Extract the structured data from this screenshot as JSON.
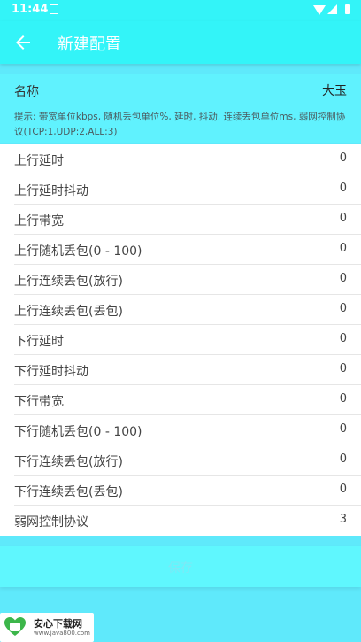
{
  "status_bar": {
    "time": "11:44"
  },
  "app_bar": {
    "title": "新建配置"
  },
  "name_field": {
    "label": "名称",
    "value": "大玉"
  },
  "hint": "提示: 带宽单位kbps, 随机丢包单位%, 延时, 抖动, 连续丢包单位ms, 弱网控制协议(TCP:1,UDP:2,ALL:3)",
  "settings": [
    {
      "label": "上行延时",
      "value": "0"
    },
    {
      "label": "上行延时抖动",
      "value": "0"
    },
    {
      "label": "上行带宽",
      "value": "0"
    },
    {
      "label": "上行随机丢包(0 - 100)",
      "value": "0"
    },
    {
      "label": "上行连续丢包(放行)",
      "value": "0"
    },
    {
      "label": "上行连续丢包(丢包)",
      "value": "0"
    },
    {
      "label": "下行延时",
      "value": "0"
    },
    {
      "label": "下行延时抖动",
      "value": "0"
    },
    {
      "label": "下行带宽",
      "value": "0"
    },
    {
      "label": "下行随机丢包(0 - 100)",
      "value": "0"
    },
    {
      "label": "下行连续丢包(放行)",
      "value": "0"
    },
    {
      "label": "下行连续丢包(丢包)",
      "value": "0"
    },
    {
      "label": "弱网控制协议",
      "value": "3"
    }
  ],
  "save_button": {
    "label": "保存"
  },
  "watermark": {
    "title": "安心下载网",
    "url": "www.java800.com"
  },
  "icons": {
    "back": "arrow-left-icon",
    "notification": "notification-icon",
    "wifi": "wifi-icon",
    "signal": "signal-icon",
    "battery": "battery-icon",
    "watermark_logo": "heart-logo-icon"
  },
  "colors": {
    "app_bar": "#33f4f8",
    "background": "#5fe9fb",
    "list_background": "#ffffff",
    "save_text": "#7fe7f4"
  }
}
